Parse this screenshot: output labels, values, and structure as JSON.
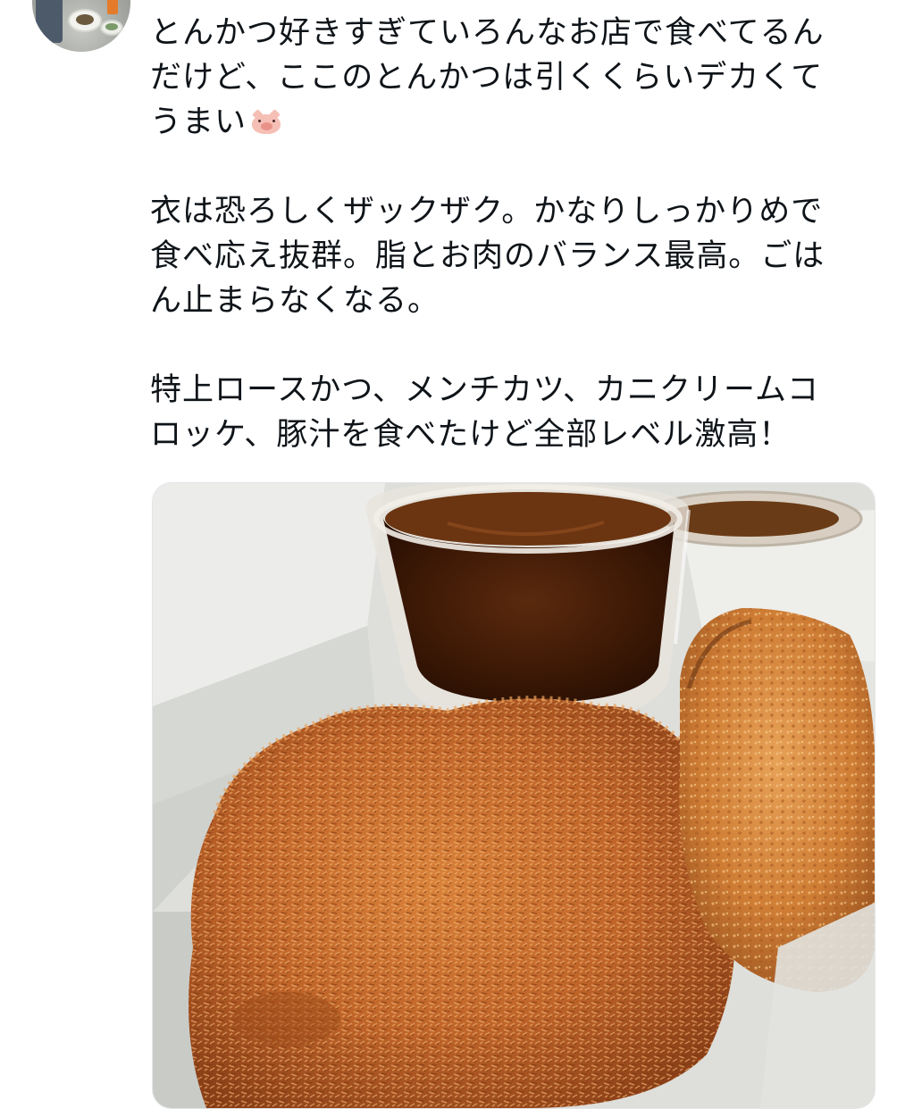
{
  "tweet": {
    "paragraphs": [
      {
        "lines": [
          "とんかつ好きすぎていろんなお店で食べてるん",
          "だけど、ここのとんかつは引くくらいデカくて",
          "うまい"
        ],
        "trailing_emoji": "pig-face-icon"
      },
      {
        "lines": [
          "衣は恐ろしくザックザク。かなりしっかりめで",
          "食べ応え抜群。脂とお肉のバランス最高。ごは",
          "ん止まらなくなる。"
        ]
      },
      {
        "lines": [
          "特上ロースかつ、メンチカツ、カニクリームコ",
          "ロッケ、豚汁を食べたけど全部レベル激高！"
        ]
      }
    ]
  },
  "colors": {
    "text": "#0f1419",
    "background": "#ffffff",
    "media_border": "#e3e6e8"
  }
}
